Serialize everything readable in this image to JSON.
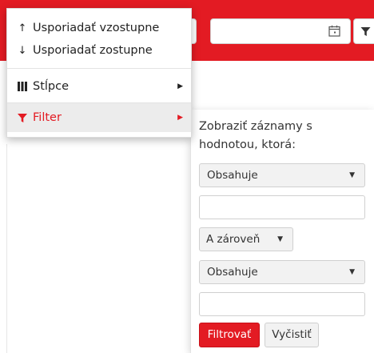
{
  "colors": {
    "accent": "#e31b23",
    "menu_active_bg": "#ececec",
    "select_bg": "#f2f2f2"
  },
  "toolbar": {
    "date_icon": "calendar-icon",
    "filter_icon": "filter-icon"
  },
  "menu": {
    "sort_asc": {
      "icon": "↑",
      "label": "Usporiadať vzostupne"
    },
    "sort_desc": {
      "icon": "↓",
      "label": "Usporiadať zostupne"
    },
    "columns": {
      "icon": "columns-icon",
      "label": "Stĺpce",
      "arrow": "▶"
    },
    "filter": {
      "icon": "filter-icon",
      "label": "Filter",
      "arrow": "▶"
    }
  },
  "filter_panel": {
    "description": "Zobraziť záznamy s hodnotou, ktorá:",
    "operator_1": "Obsahuje",
    "value_1": "",
    "logic": "A zároveň",
    "operator_2": "Obsahuje",
    "value_2": "",
    "caret": "▼",
    "filter_button": "Filtrovať",
    "clear_button": "Vyčistiť"
  }
}
